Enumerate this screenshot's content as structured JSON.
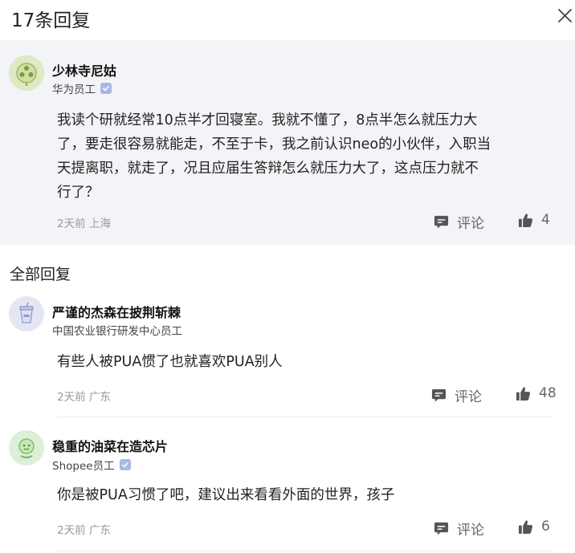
{
  "header": {
    "title": "17条回复"
  },
  "main_comment": {
    "username": "少林寺尼姑",
    "company": "华为员工",
    "verified": true,
    "lines": [
      "我读个研就经常10点半才回寝室。我就不懂了，8点半怎么就压力大",
      "了，要走很容易就能走，不至于卡，我之前认识neo的小伙伴，入职当",
      "天提离职，就走了，况且应届生答辩怎么就压力大了，这点压力就不",
      "行了？"
    ],
    "time": "2天前",
    "location": "上海",
    "comment_label": "评论",
    "likes": "4"
  },
  "replies_title": "全部回复",
  "replies": [
    {
      "username": "严谨的杰森在披荆斩棘",
      "company": "中国农业银行研发中心员工",
      "verified": false,
      "text": "有些人被PUA惯了也就喜欢PUA别人",
      "time": "2天前",
      "location": "广东",
      "comment_label": "评论",
      "likes": "48"
    },
    {
      "username": "稳重的油菜在造芯片",
      "company": "Shopee员工",
      "verified": true,
      "text": "你是被PUA习惯了吧，建议出来看看外面的世界，孩子",
      "time": "2天前",
      "location": "广东",
      "comment_label": "评论",
      "likes": "6"
    }
  ],
  "icons": {
    "close": "close-icon",
    "comment": "comment-icon",
    "like": "thumbs-up-icon",
    "verified": "verified-badge-icon"
  },
  "colors": {
    "main_bg": "#f3f4f7",
    "meta_text": "#9a9a9a",
    "icon": "#555555",
    "badge": "#a8b8e3"
  }
}
